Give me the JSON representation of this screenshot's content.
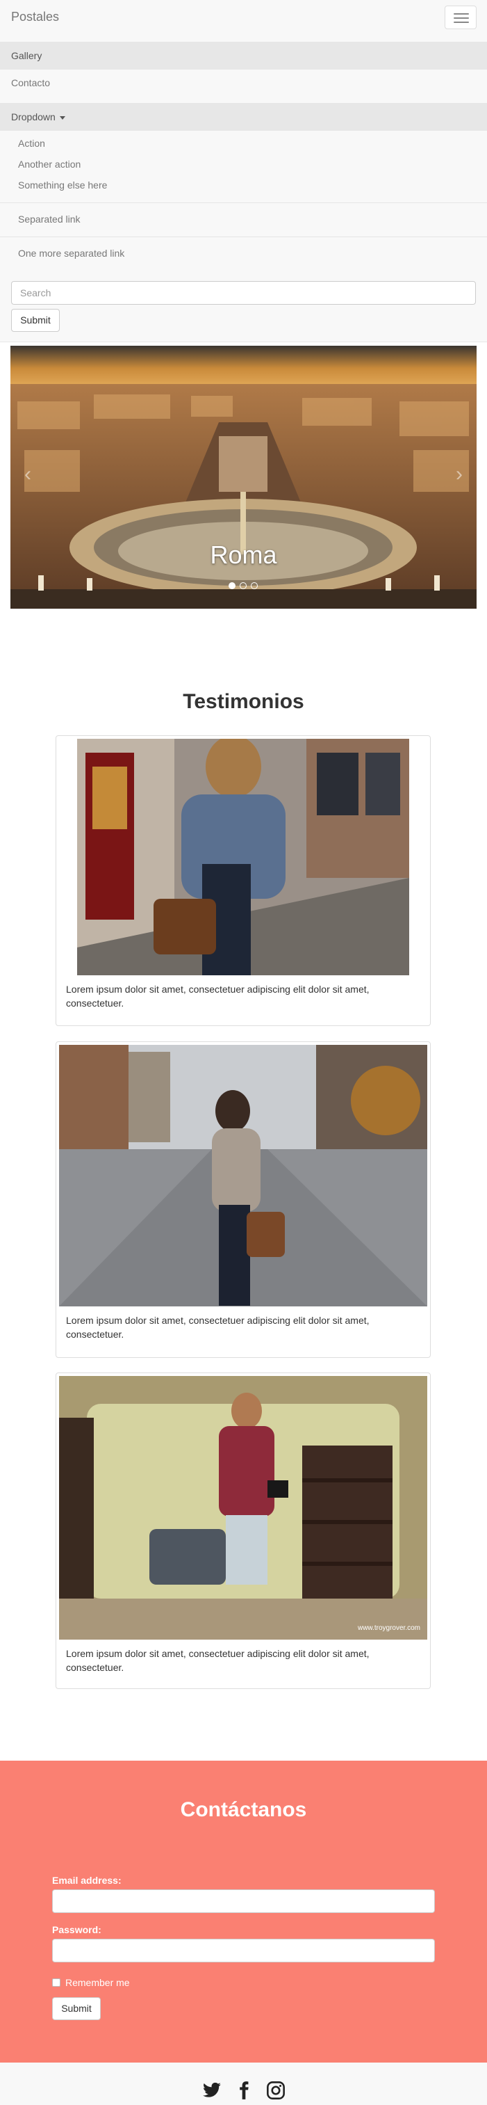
{
  "navbar": {
    "brand": "Postales",
    "items": [
      {
        "label": "Gallery"
      },
      {
        "label": "Contacto"
      }
    ],
    "dropdown": {
      "label": "Dropdown",
      "items": [
        "Action",
        "Another action",
        "Something else here"
      ],
      "separated": [
        "Separated link",
        "One more separated link"
      ]
    },
    "search_placeholder": "Search",
    "submit_label": "Submit"
  },
  "carousel": {
    "caption": "Roma",
    "prev_icon": "chevron-left-icon",
    "next_icon": "chevron-right-icon",
    "slide_count": 3,
    "active_slide": 1
  },
  "testimonials": {
    "title": "Testimonios",
    "cards": [
      {
        "text": "Lorem ipsum dolor sit amet, consectetuer adipiscing elit dolor sit amet, consectetuer."
      },
      {
        "text": "Lorem ipsum dolor sit amet, consectetuer adipiscing elit dolor sit amet, consectetuer."
      },
      {
        "text": "Lorem ipsum dolor sit amet, consectetuer adipiscing elit dolor sit amet, consectetuer.",
        "watermark": "www.troygrover.com"
      }
    ]
  },
  "contact": {
    "title": "Contáctanos",
    "email_label": "Email address:",
    "password_label": "Password:",
    "remember_label": "Remember me",
    "submit_label": "Submit",
    "background_color": "#fa8072"
  },
  "footer": {
    "icons": [
      "twitter-icon",
      "facebook-icon",
      "instagram-icon"
    ]
  }
}
